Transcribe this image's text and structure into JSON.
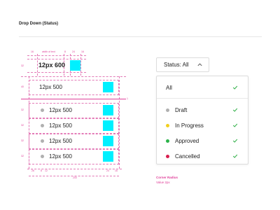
{
  "page": {
    "title": "Drop Down (Status)"
  },
  "spec": {
    "header_text": "12px 600",
    "row_text": "12px 500",
    "width_annotation": "width of text",
    "measures": {
      "top_left": "16",
      "top_mid": "8",
      "top_r1": "24",
      "top_r2": "16",
      "side_a": "32",
      "side_b": "40",
      "side_c": "1",
      "side_d": "32",
      "bottom_a": "26",
      "bottom_b": "8",
      "bottom_c": "12",
      "bottom_d": "24",
      "bottom_e": "16",
      "total_width": "200"
    }
  },
  "dropdown": {
    "trigger_label": "Status: All",
    "options": [
      {
        "label": "All",
        "dot": "",
        "checked": true
      },
      {
        "label": "Draft",
        "dot": "#b0b0b0",
        "checked": true
      },
      {
        "label": "In Progress",
        "dot": "#f2cf1d",
        "checked": true
      },
      {
        "label": "Approved",
        "dot": "#2bb34a",
        "checked": true
      },
      {
        "label": "Cancelled",
        "dot": "#d81e4f",
        "checked": true
      }
    ],
    "check_color": "#37b24d"
  },
  "notes": {
    "radius_title": "Corner Radius",
    "radius_value": "Value 2px"
  }
}
